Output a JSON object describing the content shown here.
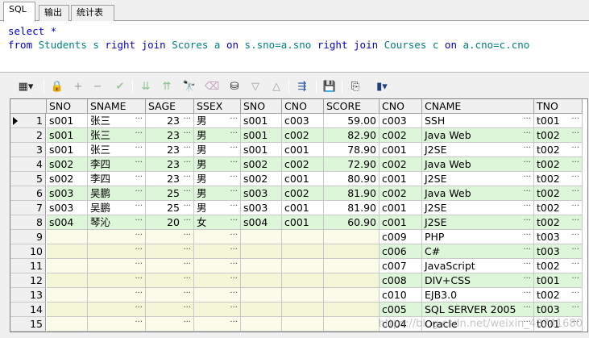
{
  "tabs": [
    {
      "label": "SQL",
      "active": true
    },
    {
      "label": "输出",
      "active": false
    },
    {
      "label": "统计表",
      "active": false
    }
  ],
  "editor": {
    "line1": "select *",
    "line2_tokens": [
      {
        "t": "from",
        "k": "kw"
      },
      {
        "t": " Students s ",
        "k": "id"
      },
      {
        "t": "right join",
        "k": "kw"
      },
      {
        "t": " Scores a ",
        "k": "id"
      },
      {
        "t": "on",
        "k": "kw"
      },
      {
        "t": " s.sno=a.sno ",
        "k": "id"
      },
      {
        "t": "right join",
        "k": "kw"
      },
      {
        "t": " Courses c ",
        "k": "id"
      },
      {
        "t": "on",
        "k": "kw"
      },
      {
        "t": " a.cno=c.cno",
        "k": "id"
      }
    ]
  },
  "toolbar": {
    "icons": [
      "grid-menu-icon",
      "lock-icon",
      "add-record-icon",
      "delete-record-icon",
      "post-icon",
      "filter-down-icon",
      "filter-up-icon",
      "find-icon",
      "clear-icon",
      "query-by-example-icon",
      "triangle-down-icon",
      "triangle-up-icon",
      "link-icon",
      "save-icon",
      "export-icon",
      "chart-icon"
    ]
  },
  "grid": {
    "columns": [
      "SNO",
      "SNAME",
      "SAGE",
      "SSEX",
      "SNO",
      "CNO",
      "SCORE",
      "CNO",
      "CNAME",
      "TNO"
    ],
    "rows": [
      [
        "1",
        "s001",
        "张三",
        "23",
        "男",
        "s001",
        "c003",
        "59.00",
        "c003",
        "SSH",
        "t001"
      ],
      [
        "2",
        "s001",
        "张三",
        "23",
        "男",
        "s001",
        "c002",
        "82.90",
        "c002",
        "Java Web",
        "t002"
      ],
      [
        "3",
        "s001",
        "张三",
        "23",
        "男",
        "s001",
        "c001",
        "78.90",
        "c001",
        "J2SE",
        "t002"
      ],
      [
        "4",
        "s002",
        "李四",
        "23",
        "男",
        "s002",
        "c002",
        "72.90",
        "c002",
        "Java Web",
        "t002"
      ],
      [
        "5",
        "s002",
        "李四",
        "23",
        "男",
        "s002",
        "c001",
        "80.90",
        "c001",
        "J2SE",
        "t002"
      ],
      [
        "6",
        "s003",
        "吴鹏",
        "25",
        "男",
        "s003",
        "c002",
        "81.90",
        "c002",
        "Java Web",
        "t002"
      ],
      [
        "7",
        "s003",
        "吴鹏",
        "25",
        "男",
        "s003",
        "c001",
        "81.90",
        "c001",
        "J2SE",
        "t002"
      ],
      [
        "8",
        "s004",
        "琴沁",
        "20",
        "女",
        "s004",
        "c001",
        "60.90",
        "c001",
        "J2SE",
        "t002"
      ],
      [
        "9",
        "",
        "",
        "",
        "",
        "",
        "",
        "",
        "c009",
        "PHP",
        "t003"
      ],
      [
        "10",
        "",
        "",
        "",
        "",
        "",
        "",
        "",
        "c006",
        "C#",
        "t003"
      ],
      [
        "11",
        "",
        "",
        "",
        "",
        "",
        "",
        "",
        "c007",
        "JavaScript",
        "t002"
      ],
      [
        "12",
        "",
        "",
        "",
        "",
        "",
        "",
        "",
        "c008",
        "DIV+CSS",
        "t001"
      ],
      [
        "13",
        "",
        "",
        "",
        "",
        "",
        "",
        "",
        "c010",
        "EJB3.0",
        "t002"
      ],
      [
        "14",
        "",
        "",
        "",
        "",
        "",
        "",
        "",
        "c005",
        "SQL SERVER 2005",
        "t003"
      ],
      [
        "15",
        "",
        "",
        "",
        "",
        "",
        "",
        "",
        "c004",
        "Oracle",
        "t001"
      ]
    ]
  },
  "watermark": "https://blog.csdn.net/weixin_43741680"
}
